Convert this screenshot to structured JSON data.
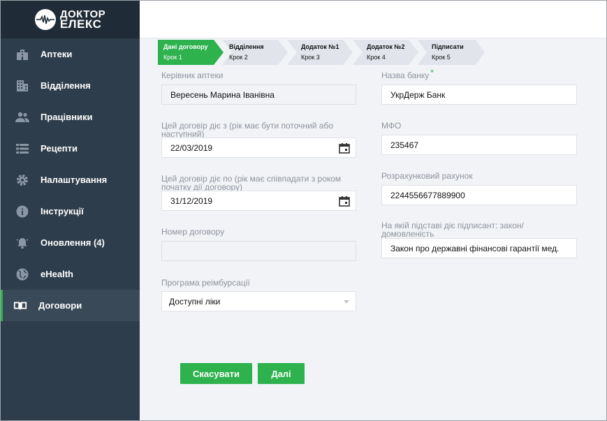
{
  "logo": {
    "line1": "ДОКТОР",
    "line2": "ЕЛЕКС"
  },
  "sidebar": {
    "items": [
      {
        "label": "Аптеки",
        "icon": "building-icon"
      },
      {
        "label": "Відділення",
        "icon": "office-icon"
      },
      {
        "label": "Працівники",
        "icon": "people-icon"
      },
      {
        "label": "Рецепти",
        "icon": "list-icon"
      },
      {
        "label": "Налаштування",
        "icon": "gear-icon"
      },
      {
        "label": "Інструкції",
        "icon": "info-icon"
      },
      {
        "label": "Оновлення (4)",
        "icon": "bell-icon"
      },
      {
        "label": "eHealth",
        "icon": "globe-icon"
      },
      {
        "label": "Договори",
        "icon": "book-icon",
        "active": true
      }
    ]
  },
  "steps": [
    {
      "title": "Дані договору",
      "sub": "Крок 1",
      "active": true
    },
    {
      "title": "Відділення",
      "sub": "Крок 2"
    },
    {
      "title": "Додаток №1",
      "sub": "Крок 3"
    },
    {
      "title": "Додаток №2",
      "sub": "Крок 4"
    },
    {
      "title": "Підписати",
      "sub": "Крок 5"
    }
  ],
  "form": {
    "head": {
      "label": "Керівник аптеки",
      "value": "Вересень Марина Іванівна"
    },
    "valid_from": {
      "label_line1": "Цей договір діє з (рік має бути поточний або",
      "label_line2": "наступний)",
      "value": "22/03/2019"
    },
    "valid_to": {
      "label_line1": "Цей договір діє по (рік має співпадати з роком",
      "label_line2": "початку дії договору)",
      "value": "31/12/2019"
    },
    "contract_no": {
      "label": "Номер договору",
      "value": ""
    },
    "program": {
      "label": "Програма реімбурсації",
      "value": "Доступні ліки"
    },
    "bank": {
      "label": "Назва банку",
      "required": "*",
      "value": "УкрДерж Банк"
    },
    "mfo": {
      "label": "МФО",
      "value": "235467"
    },
    "account": {
      "label": "Розрахунковий рахунок",
      "value": "2244556677889900"
    },
    "basis": {
      "label_line1": "На якій підставі діє підписант: закон/",
      "label_line2": "домовленість",
      "value": "Закон про державні фінансові гарантії мед."
    }
  },
  "buttons": {
    "cancel": "Скасувати",
    "next": "Далі"
  },
  "colors": {
    "accent": "#2eb24d",
    "sidebar": "#2e3d4b",
    "sidebar_dark": "#1f2b36"
  }
}
